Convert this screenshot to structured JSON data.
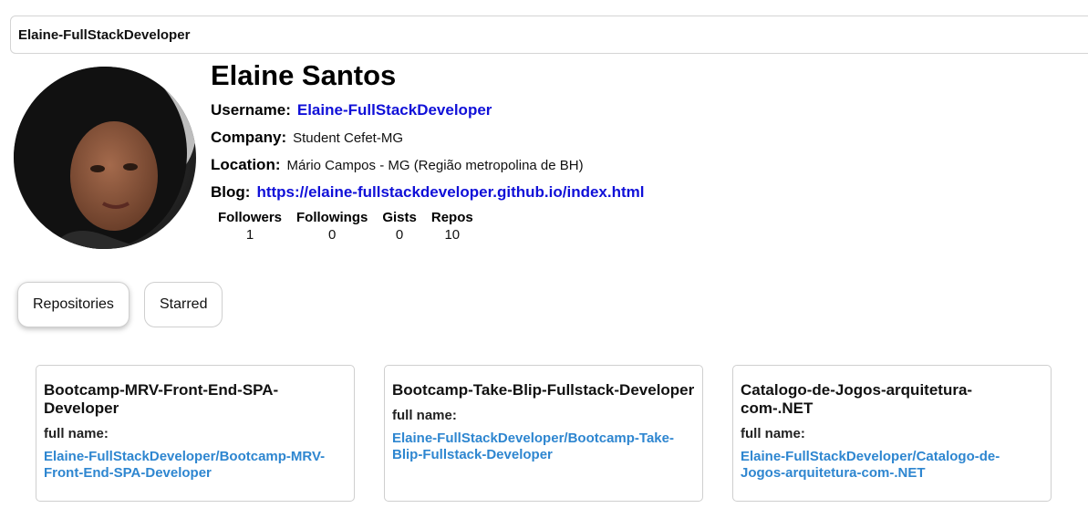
{
  "search": {
    "value": "Elaine-FullStackDeveloper"
  },
  "profile": {
    "name": "Elaine Santos",
    "username_label": "Username:",
    "username": "Elaine-FullStackDeveloper",
    "company_label": "Company:",
    "company": "Student Cefet-MG",
    "location_label": "Location:",
    "location": "Mário Campos - MG (Região metropolina de BH)",
    "blog_label": "Blog:",
    "blog": "https://elaine-fullstackdeveloper.github.io/index.html",
    "stats": [
      {
        "label": "Followers",
        "value": "1"
      },
      {
        "label": "Followings",
        "value": "0"
      },
      {
        "label": "Gists",
        "value": "0"
      },
      {
        "label": "Repos",
        "value": "10"
      }
    ]
  },
  "tabs": [
    {
      "label": "Repositories",
      "active": true
    },
    {
      "label": "Starred",
      "active": false
    }
  ],
  "repos": [
    {
      "title": "Bootcamp-MRV-Front-End-SPA-Developer",
      "full_name_label": "full name:",
      "full_name": "Elaine-FullStackDeveloper/Bootcamp-MRV-Front-End-SPA-Developer"
    },
    {
      "title": "Bootcamp-Take-Blip-Fullstack-Developer",
      "full_name_label": "full name:",
      "full_name": "Elaine-FullStackDeveloper/Bootcamp-Take-Blip-Fullstack-Developer"
    },
    {
      "title": "Catalogo-de-Jogos-arquitetura-com-.NET",
      "full_name_label": "full name:",
      "full_name": "Elaine-FullStackDeveloper/Catalogo-de-Jogos-arquitetura-com-.NET"
    }
  ],
  "colors": {
    "link": "#1010d8",
    "repo_link": "#2e86d0"
  }
}
